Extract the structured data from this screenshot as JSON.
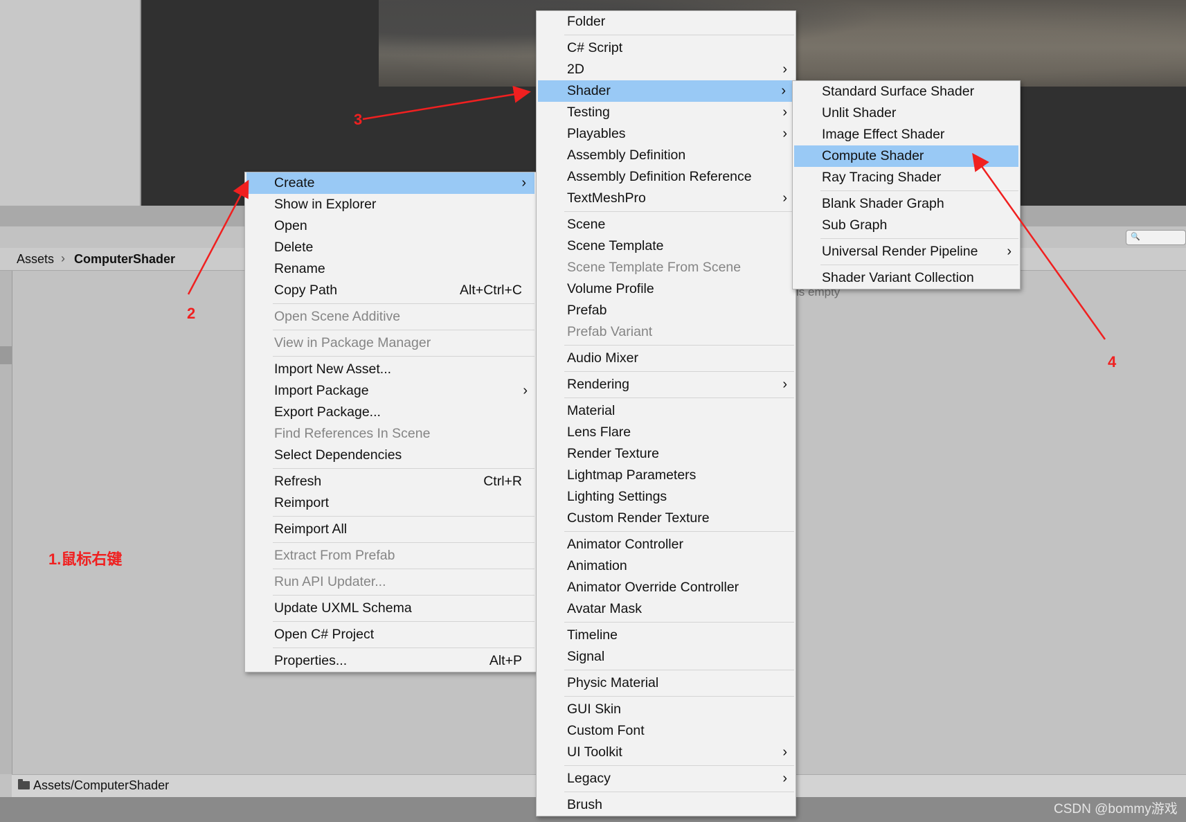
{
  "breadcrumb": {
    "root": "Assets",
    "separator": "›",
    "current": "ComputerShader"
  },
  "project_empty_text": "is empty",
  "status_path": "Assets/ComputerShader",
  "watermark": "CSDN @bommy游戏",
  "annotations": {
    "a1": "1.鼠标右键",
    "a2": "2",
    "a3": "3",
    "a4": "4"
  },
  "annotation_color": "#f02020",
  "highlight_color": "#99c9f5",
  "context_menu": [
    {
      "label": "Create",
      "arrow": "›",
      "highlight": true
    },
    {
      "label": "Show in Explorer"
    },
    {
      "label": "Open"
    },
    {
      "label": "Delete"
    },
    {
      "label": "Rename"
    },
    {
      "label": "Copy Path",
      "shortcut": "Alt+Ctrl+C"
    },
    {
      "sep": true
    },
    {
      "label": "Open Scene Additive",
      "disabled": true
    },
    {
      "sep": true
    },
    {
      "label": "View in Package Manager",
      "disabled": true
    },
    {
      "sep": true
    },
    {
      "label": "Import New Asset..."
    },
    {
      "label": "Import Package",
      "arrow": "›"
    },
    {
      "label": "Export Package..."
    },
    {
      "label": "Find References In Scene",
      "disabled": true
    },
    {
      "label": "Select Dependencies"
    },
    {
      "sep": true
    },
    {
      "label": "Refresh",
      "shortcut": "Ctrl+R"
    },
    {
      "label": "Reimport"
    },
    {
      "sep": true
    },
    {
      "label": "Reimport All"
    },
    {
      "sep": true
    },
    {
      "label": "Extract From Prefab",
      "disabled": true
    },
    {
      "sep": true
    },
    {
      "label": "Run API Updater...",
      "disabled": true
    },
    {
      "sep": true
    },
    {
      "label": "Update UXML Schema"
    },
    {
      "sep": true
    },
    {
      "label": "Open C# Project"
    },
    {
      "sep": true
    },
    {
      "label": "Properties...",
      "shortcut": "Alt+P"
    }
  ],
  "create_submenu": [
    {
      "label": "Folder"
    },
    {
      "sep": true
    },
    {
      "label": "C# Script"
    },
    {
      "label": "2D",
      "arrow": "›"
    },
    {
      "label": "Shader",
      "arrow": "›",
      "highlight": true
    },
    {
      "label": "Testing",
      "arrow": "›"
    },
    {
      "label": "Playables",
      "arrow": "›"
    },
    {
      "label": "Assembly Definition"
    },
    {
      "label": "Assembly Definition Reference"
    },
    {
      "label": "TextMeshPro",
      "arrow": "›"
    },
    {
      "sep": true
    },
    {
      "label": "Scene"
    },
    {
      "label": "Scene Template"
    },
    {
      "label": "Scene Template From Scene",
      "disabled": true
    },
    {
      "label": "Volume Profile"
    },
    {
      "label": "Prefab"
    },
    {
      "label": "Prefab Variant",
      "disabled": true
    },
    {
      "sep": true
    },
    {
      "label": "Audio Mixer"
    },
    {
      "sep": true
    },
    {
      "label": "Rendering",
      "arrow": "›"
    },
    {
      "sep": true
    },
    {
      "label": "Material"
    },
    {
      "label": "Lens Flare"
    },
    {
      "label": "Render Texture"
    },
    {
      "label": "Lightmap Parameters"
    },
    {
      "label": "Lighting Settings"
    },
    {
      "label": "Custom Render Texture"
    },
    {
      "sep": true
    },
    {
      "label": "Animator Controller"
    },
    {
      "label": "Animation"
    },
    {
      "label": "Animator Override Controller"
    },
    {
      "label": "Avatar Mask"
    },
    {
      "sep": true
    },
    {
      "label": "Timeline"
    },
    {
      "label": "Signal"
    },
    {
      "sep": true
    },
    {
      "label": "Physic Material"
    },
    {
      "sep": true
    },
    {
      "label": "GUI Skin"
    },
    {
      "label": "Custom Font"
    },
    {
      "label": "UI Toolkit",
      "arrow": "›"
    },
    {
      "sep": true
    },
    {
      "label": "Legacy",
      "arrow": "›"
    },
    {
      "sep": true
    },
    {
      "label": "Brush"
    }
  ],
  "shader_submenu": [
    {
      "label": "Standard Surface Shader"
    },
    {
      "label": "Unlit Shader"
    },
    {
      "label": "Image Effect Shader"
    },
    {
      "label": "Compute Shader",
      "highlight": true
    },
    {
      "label": "Ray Tracing Shader"
    },
    {
      "sep": true
    },
    {
      "label": "Blank Shader Graph"
    },
    {
      "label": "Sub Graph"
    },
    {
      "sep": true
    },
    {
      "label": "Universal Render Pipeline",
      "arrow": "›"
    },
    {
      "sep": true
    },
    {
      "label": "Shader Variant Collection"
    }
  ]
}
